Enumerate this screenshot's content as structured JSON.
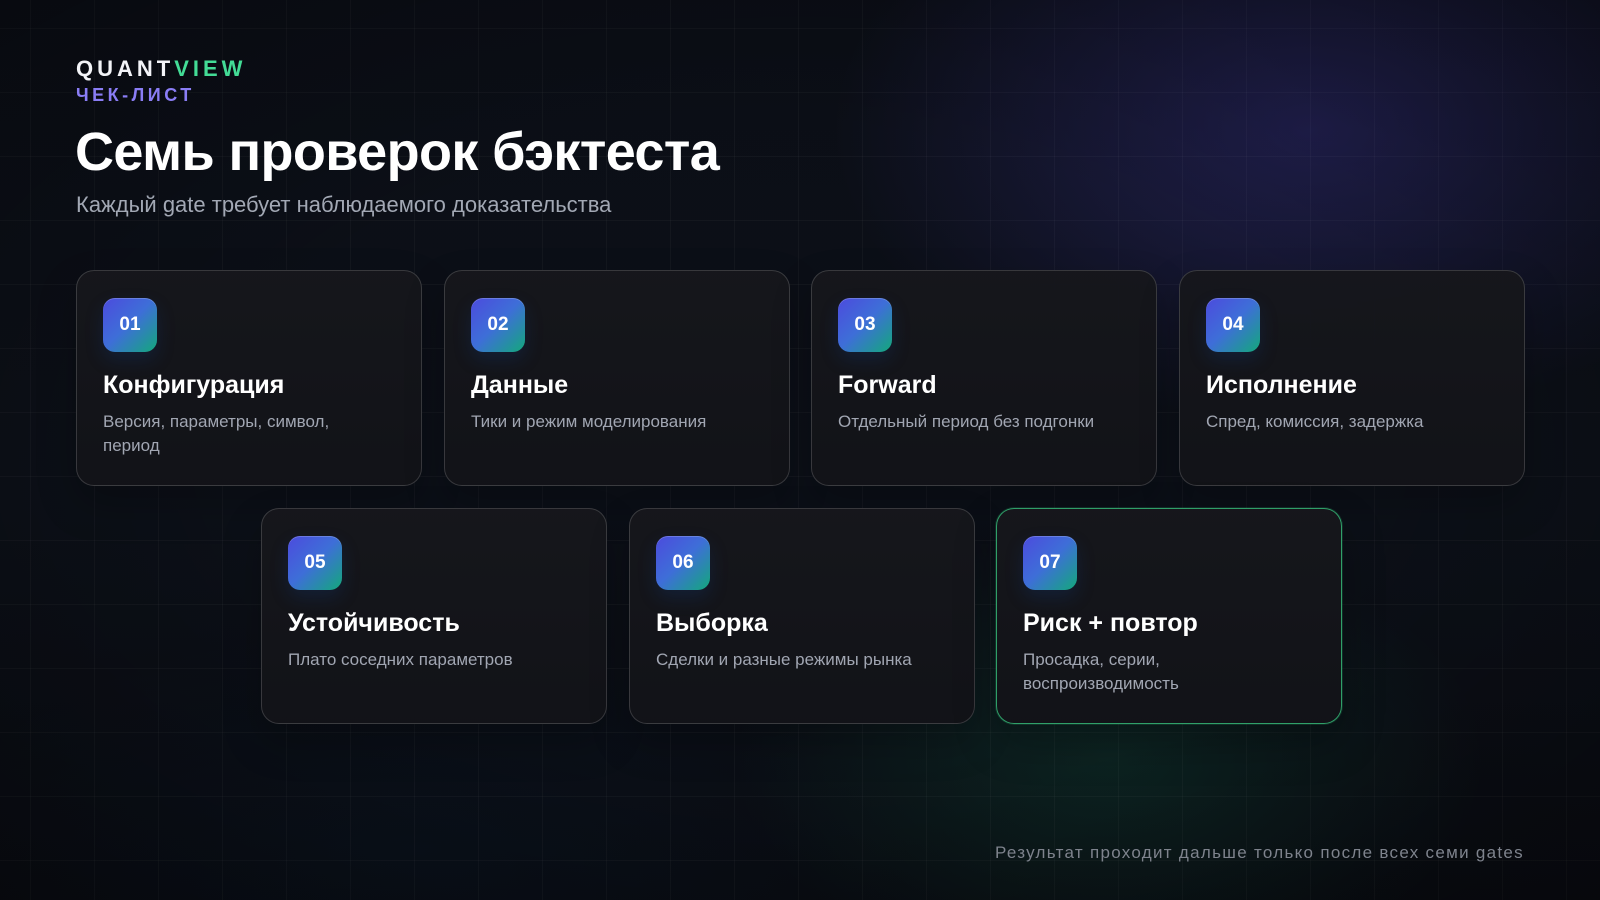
{
  "brand": {
    "primary": "QUANT",
    "accent": "VIEW",
    "checklist_label": "ЧЕК-ЛИСТ"
  },
  "header": {
    "title": "Семь проверок бэктеста",
    "subtitle": "Каждый gate требует наблюдаемого доказательства"
  },
  "cards": [
    {
      "number": "01",
      "title": "Конфигурация",
      "description": "Версия, параметры, символ, период"
    },
    {
      "number": "02",
      "title": "Данные",
      "description": "Тики и режим моделирования"
    },
    {
      "number": "03",
      "title": "Forward",
      "description": "Отдельный период без подгонки"
    },
    {
      "number": "04",
      "title": "Исполнение",
      "description": "Спред, комиссия, задержка"
    },
    {
      "number": "05",
      "title": "Устойчивость",
      "description": "Плато соседних параметров"
    },
    {
      "number": "06",
      "title": "Выборка",
      "description": "Сделки и разные режимы рынка"
    },
    {
      "number": "07",
      "title": "Риск + повтор",
      "description": "Просадка, серии, воспроизводимость"
    }
  ],
  "footer": {
    "note": "Результат проходит дальше только после всех семи gates"
  },
  "colors": {
    "background": "#0b0d13",
    "brand_accent": "#43dc96",
    "checklist_label": "#8a7df5",
    "card_border": "#2b2e35",
    "final_card_border": "#3ad084",
    "badge_start": "#4c4bdd",
    "badge_end": "#13a87b"
  }
}
